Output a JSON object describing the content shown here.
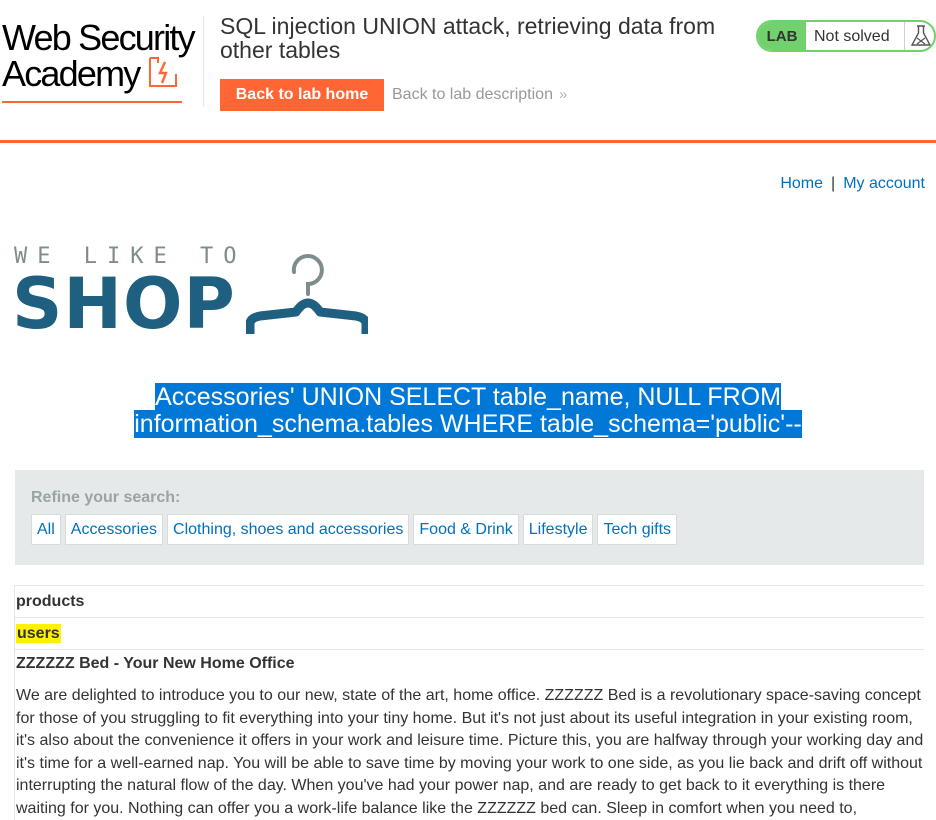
{
  "header": {
    "logo_line1": "Web Security",
    "logo_line2": "Academy",
    "lab_title": "SQL injection UNION attack, retrieving data from other tables",
    "back_home_label": "Back to lab home",
    "back_description_label": "Back to lab description",
    "status_tag": "LAB",
    "status_text": "Not solved",
    "accent_color": "#ff6633",
    "status_color": "#70d16d",
    "icons": [
      "lightning-bolt-icon",
      "double-chevron-right-icon",
      "flask-icon"
    ]
  },
  "nav": {
    "home": "Home",
    "separator": "|",
    "my_account": "My account"
  },
  "shop_logo": {
    "tagline": "WE LIKE TO",
    "word": "SHOP",
    "icon": "hanger-icon"
  },
  "search": {
    "heading_line1": "Accessories' UNION SELECT table_name, NULL FROM",
    "heading_line2": "information_schema.tables WHERE table_schema='public'--",
    "selection_color": "#0078d7"
  },
  "filters": {
    "label": "Refine your search:",
    "items": [
      "All",
      "Accessories",
      "Clothing, shoes and accessories",
      "Food & Drink",
      "Lifestyle",
      "Tech gifts"
    ]
  },
  "results": {
    "rows": [
      "products",
      "users"
    ],
    "highlight_color": "#fff200",
    "product_title": "ZZZZZZ Bed - Your New Home Office",
    "product_description": "We are delighted to introduce you to our new, state of the art, home office. ZZZZZZ Bed is a revolutionary space-saving concept for those of you struggling to fit everything into your tiny home. But it's not just about its useful integration in your existing room, it's also about the convenience it offers in your work and leisure time. Picture this, you are halfway through your working day and it's time for a well-earned nap. You will be able to save time by moving your work to one side, as you lie back and drift off without interrupting the natural flow of the day. When you've had your power nap, and are ready to get back to it everything is there waiting for you. Nothing can offer you a work-life balance like the ZZZZZZ bed can. Sleep in comfort when you need to,"
  }
}
